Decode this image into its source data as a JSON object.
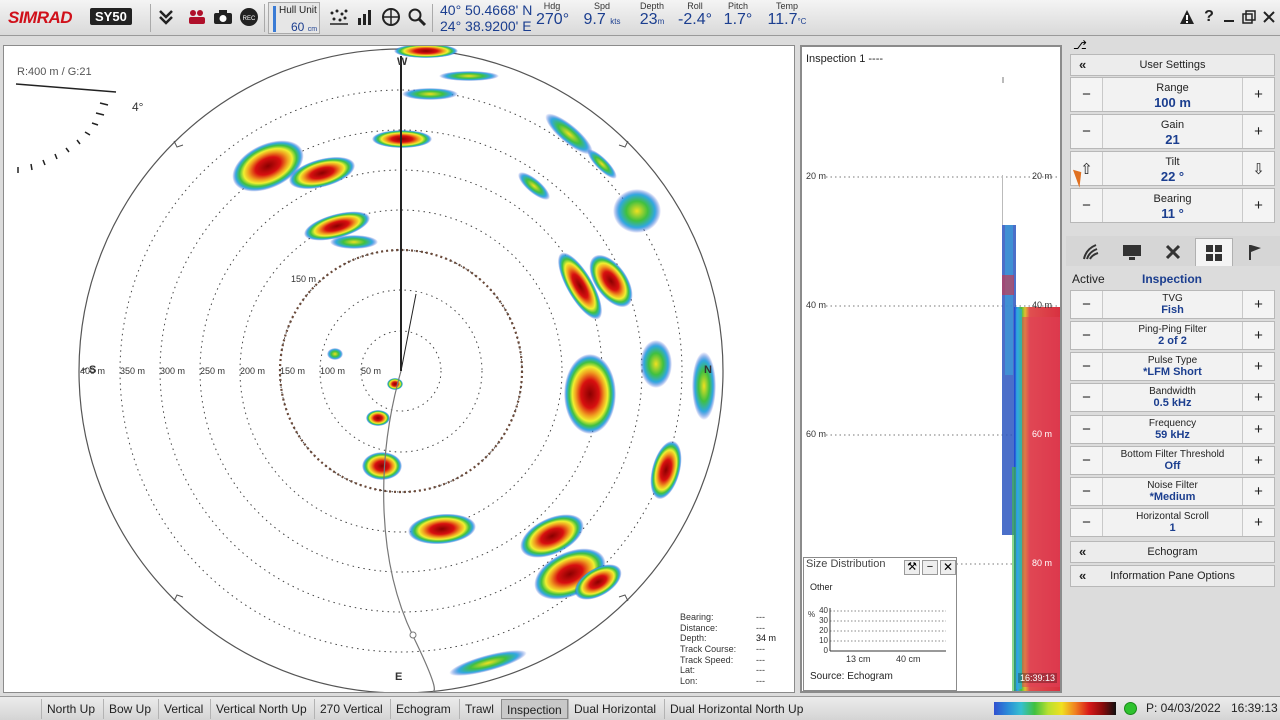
{
  "topbar": {
    "brand": "SIMRAD",
    "model": "SY50",
    "hull_unit_label": "Hull Unit",
    "hull_unit_value": "60",
    "hull_unit_unit": "cm",
    "lat": "40° 50.4668' N",
    "lon": "24° 38.9200' E",
    "hdg_label": "Hdg",
    "hdg_value": "270°",
    "spd_label": "Spd",
    "spd_value": "9.7",
    "spd_unit": "kts",
    "depth_label": "Depth",
    "depth_value": "23",
    "depth_unit": "m",
    "roll_label": "Roll",
    "roll_value": "-2.4°",
    "pitch_label": "Pitch",
    "pitch_value": "1.7°",
    "temp_label": "Temp",
    "temp_value": "11.7",
    "temp_unit": "°C"
  },
  "sonar": {
    "range_gain": "R:400 m  / G:21",
    "tilt_indicator": "4°",
    "north_label": "W",
    "south_label": "E",
    "west_label": "S",
    "east_label": "N",
    "range_labels": [
      "400 m",
      "350 m",
      "300 m",
      "250 m",
      "200 m",
      "150 m",
      "100 m",
      "50 m"
    ],
    "inner_range_label": "150 m",
    "info": {
      "bearing_label": "Bearing:",
      "bearing_value": "---",
      "distance_label": "Distance:",
      "distance_value": "---",
      "depth_label": "Depth:",
      "depth_value": "34 m",
      "track_course_label": "Track Course:",
      "track_course_value": "---",
      "track_speed_label": "Track Speed:",
      "track_speed_value": "---",
      "lat_label": "Lat:",
      "lat_value": "---",
      "lon_label": "Lon:",
      "lon_value": "---"
    }
  },
  "echogram": {
    "title": "Inspection 1",
    "depth_labels": [
      "20 m",
      "40 m",
      "60 m",
      "80 m"
    ],
    "timestamp": "16:39:13"
  },
  "size_distribution": {
    "title": "Size Distribution",
    "category": "Other",
    "y_axis_unit": "%",
    "y_ticks": [
      "40",
      "30",
      "20",
      "10",
      "0"
    ],
    "x_ticks": [
      "13 cm",
      "40 cm"
    ],
    "source": "Source: Echogram"
  },
  "right_panel": {
    "user_settings": "User Settings",
    "range_label": "Range",
    "range_value": "100 m",
    "gain_label": "Gain",
    "gain_value": "21",
    "tilt_label": "Tilt",
    "tilt_value": "22 °",
    "bearing_label": "Bearing",
    "bearing_value": "11 °",
    "active_label": "Active",
    "active_value": "Inspection",
    "settings": [
      {
        "label": "TVG",
        "value": "Fish"
      },
      {
        "label": "Ping-Ping Filter",
        "value": "2 of 2"
      },
      {
        "label": "Pulse Type",
        "value": "*LFM Short"
      },
      {
        "label": "Bandwidth",
        "value": "0.5 kHz"
      },
      {
        "label": "Frequency",
        "value": "59 kHz"
      },
      {
        "label": "Bottom Filter Threshold",
        "value": "Off"
      },
      {
        "label": "Noise Filter",
        "value": "*Medium"
      },
      {
        "label": "Horizontal Scroll",
        "value": "1"
      }
    ],
    "echogram_button": "Echogram",
    "info_pane_button": "Information Pane Options"
  },
  "bottombar": {
    "modes": [
      "North Up",
      "Bow Up",
      "Vertical",
      "Vertical North Up",
      "270 Vertical",
      "Echogram",
      "Trawl",
      "Inspection",
      "Dual Horizontal",
      "Dual Horizontal North Up"
    ],
    "selected_mode": "Inspection",
    "playback": "P: 04/03/2022",
    "clock": "16:39:13"
  },
  "colors": {
    "accent_blue": "#1b3e8f",
    "brand_red": "#d0101a",
    "status_green": "#2ec22e"
  }
}
